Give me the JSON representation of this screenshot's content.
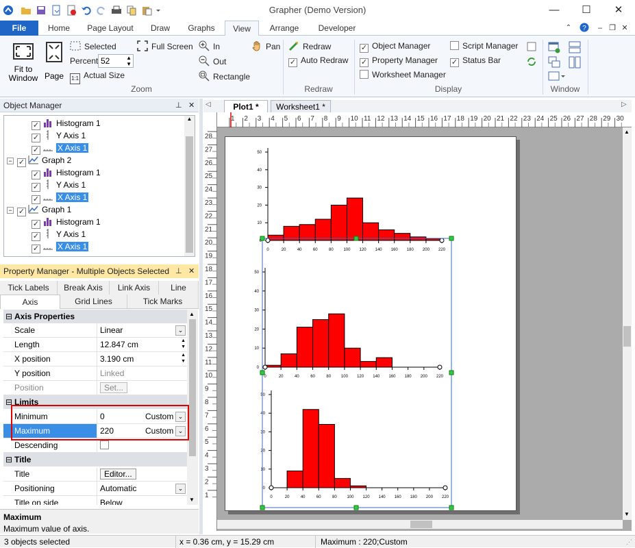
{
  "app": {
    "title": "Grapher (Demo Version)",
    "window_buttons": [
      "—",
      "☐",
      "✕"
    ]
  },
  "ribbon_tabs": [
    "File",
    "Home",
    "Page Layout",
    "Draw",
    "Graphs",
    "View",
    "Arrange",
    "Developer"
  ],
  "ribbon": {
    "zoom": {
      "fit_to_window": "Fit to Window",
      "page": "Page",
      "selected": "Selected",
      "full_screen": "Full Screen",
      "percent_label": "Percent",
      "percent_value": "52",
      "actual_size": "Actual Size",
      "zoom_in": "In",
      "zoom_out": "Out",
      "rectangle": "Rectangle",
      "pan": "Pan",
      "group_label": "Zoom"
    },
    "redraw": {
      "redraw": "Redraw",
      "auto_redraw": "Auto Redraw",
      "group_label": "Redraw"
    },
    "display": {
      "object_manager": "Object Manager",
      "property_manager": "Property Manager",
      "worksheet_manager": "Worksheet Manager",
      "script_manager": "Script Manager",
      "status_bar": "Status Bar",
      "group_label": "Display"
    },
    "window": {
      "group_label": "Window"
    }
  },
  "object_manager": {
    "title": "Object Manager",
    "tree": [
      {
        "label": "Histogram 1",
        "level": 2,
        "icon": "histogram-icon"
      },
      {
        "label": "Y Axis 1",
        "level": 2,
        "icon": "y-axis-icon"
      },
      {
        "label": "X Axis 1",
        "level": 2,
        "icon": "x-axis-icon",
        "selected": true
      },
      {
        "label": "Graph 2",
        "level": 1,
        "icon": "graph-icon"
      },
      {
        "label": "Histogram 1",
        "level": 2,
        "icon": "histogram-icon"
      },
      {
        "label": "Y Axis 1",
        "level": 2,
        "icon": "y-axis-icon"
      },
      {
        "label": "X Axis 1",
        "level": 2,
        "icon": "x-axis-icon",
        "selected": true
      },
      {
        "label": "Graph 1",
        "level": 1,
        "icon": "graph-icon"
      },
      {
        "label": "Histogram 1",
        "level": 2,
        "icon": "histogram-icon"
      },
      {
        "label": "Y Axis 1",
        "level": 2,
        "icon": "y-axis-icon"
      },
      {
        "label": "X Axis 1",
        "level": 2,
        "icon": "x-axis-icon",
        "selected": true
      }
    ]
  },
  "property_manager": {
    "title": "Property Manager - Multiple Objects Selected",
    "tabs_row1": [
      "Tick Labels",
      "Break Axis",
      "Link Axis",
      "Line"
    ],
    "tabs_row2": [
      "Axis",
      "Grid Lines",
      "Tick Marks"
    ],
    "sections": {
      "axis_properties": "Axis Properties",
      "limits": "Limits",
      "title": "Title"
    },
    "rows": {
      "scale": {
        "label": "Scale",
        "value": "Linear"
      },
      "length": {
        "label": "Length",
        "value": "12.847 cm"
      },
      "x_position": {
        "label": "X position",
        "value": "3.190 cm"
      },
      "y_position": {
        "label": "Y position",
        "value": "Linked"
      },
      "position": {
        "label": "Position",
        "value": "Set..."
      },
      "minimum": {
        "label": "Minimum",
        "value": "0",
        "mode": "Custom"
      },
      "maximum": {
        "label": "Maximum",
        "value": "220",
        "mode": "Custom"
      },
      "descending": {
        "label": "Descending"
      },
      "title": {
        "label": "Title",
        "value": "Editor..."
      },
      "positioning": {
        "label": "Positioning",
        "value": "Automatic"
      },
      "title_on_side": {
        "label": "Title on side",
        "value": "Below"
      }
    },
    "help": {
      "heading": "Maximum",
      "text": "Maximum value of axis."
    }
  },
  "documents": {
    "tabs": [
      "Plot1 *",
      "Worksheet1 *"
    ],
    "ruler_top": [
      "1",
      "2",
      "3",
      "4",
      "5",
      "6",
      "7",
      "8",
      "9",
      "10",
      "11",
      "12",
      "13",
      "14",
      "15",
      "16",
      "17",
      "18",
      "19",
      "20",
      "21",
      "22",
      "23",
      "24",
      "25",
      "26",
      "27",
      "28",
      "29",
      "30"
    ],
    "ruler_left": [
      "28",
      "27",
      "26",
      "25",
      "24",
      "23",
      "22",
      "21",
      "20",
      "19",
      "18",
      "17",
      "16",
      "15",
      "14",
      "13",
      "12",
      "11",
      "10",
      "9",
      "8",
      "7",
      "6",
      "5",
      "4",
      "3",
      "2",
      "1"
    ]
  },
  "chart_data": [
    {
      "type": "bar",
      "x_ticks": [
        "0",
        "20",
        "40",
        "60",
        "80",
        "100",
        "120",
        "140",
        "160",
        "180",
        "200",
        "220"
      ],
      "y_ticks": [
        "0",
        "10",
        "20",
        "30",
        "40",
        "50"
      ],
      "bins": [
        [
          0,
          20,
          3
        ],
        [
          20,
          40,
          8
        ],
        [
          40,
          60,
          9
        ],
        [
          60,
          80,
          12
        ],
        [
          80,
          100,
          20
        ],
        [
          100,
          120,
          24
        ],
        [
          120,
          140,
          10
        ],
        [
          140,
          160,
          6
        ],
        [
          160,
          180,
          4
        ],
        [
          180,
          200,
          2
        ],
        [
          200,
          220,
          1
        ]
      ],
      "xlim": [
        0,
        220
      ],
      "ylim": [
        0,
        50
      ]
    },
    {
      "type": "bar",
      "x_ticks": [
        "0",
        "20",
        "40",
        "60",
        "80",
        "100",
        "120",
        "140",
        "160",
        "180",
        "200",
        "220"
      ],
      "y_ticks": [
        "0",
        "10",
        "20",
        "30",
        "40",
        "50"
      ],
      "bins": [
        [
          0,
          20,
          1
        ],
        [
          20,
          40,
          7
        ],
        [
          40,
          60,
          21
        ],
        [
          60,
          80,
          25
        ],
        [
          80,
          100,
          28
        ],
        [
          100,
          120,
          10
        ],
        [
          120,
          140,
          3
        ],
        [
          140,
          160,
          5
        ]
      ],
      "xlim": [
        0,
        220
      ],
      "ylim": [
        0,
        50
      ]
    },
    {
      "type": "bar",
      "x_ticks": [
        "0",
        "20",
        "40",
        "60",
        "80",
        "100",
        "120",
        "140",
        "160",
        "180",
        "200",
        "220"
      ],
      "y_ticks": [
        "0",
        "10",
        "20",
        "30",
        "40",
        "50"
      ],
      "bins": [
        [
          20,
          40,
          9
        ],
        [
          40,
          60,
          42
        ],
        [
          60,
          80,
          34
        ],
        [
          80,
          100,
          5
        ],
        [
          100,
          120,
          1
        ]
      ],
      "xlim": [
        0,
        220
      ],
      "ylim": [
        0,
        50
      ]
    }
  ],
  "status_bar": {
    "selection": "3 objects selected",
    "coords": "x = 0.36 cm, y = 15.29 cm",
    "info": "Maximum : 220;Custom"
  },
  "colors": {
    "file_tab": "#1f66c6",
    "highlight": "#e00000",
    "bar_fill": "#ff0000",
    "selection": "#3a8ee6"
  }
}
